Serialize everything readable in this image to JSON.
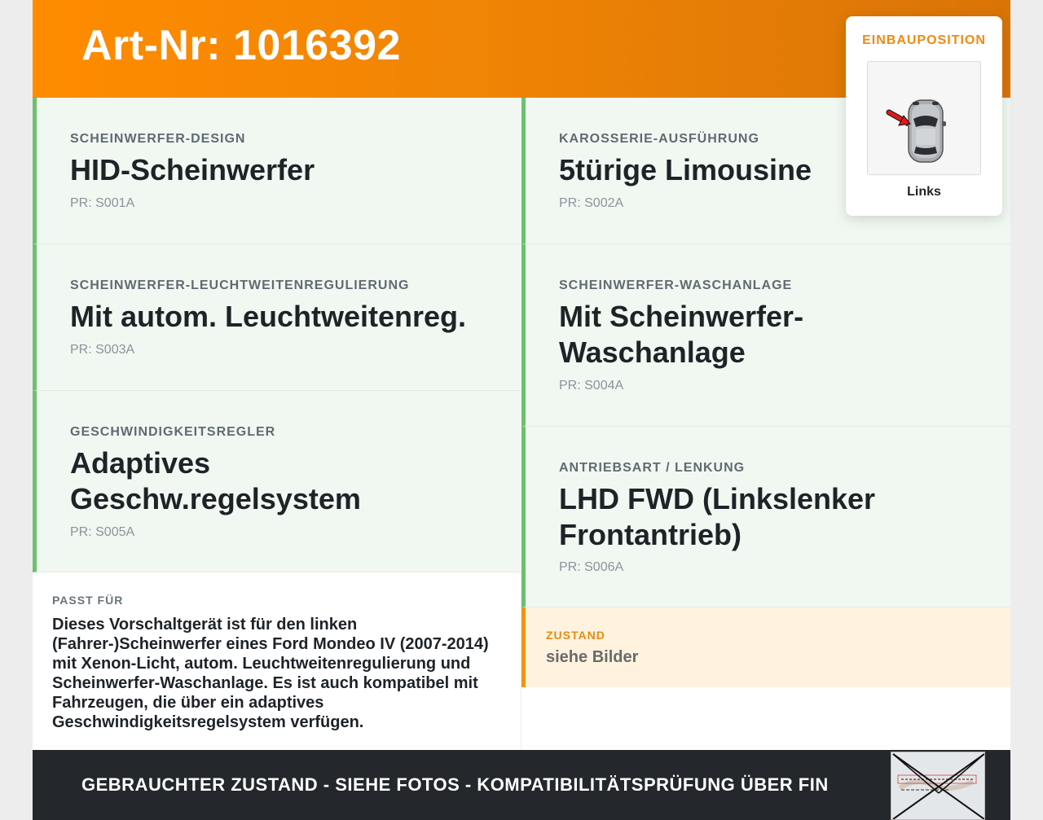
{
  "header": {
    "title": "Art-Nr: 1016392"
  },
  "specs": [
    {
      "label": "SCHEINWERFER-DESIGN",
      "value": "HID-Scheinwerfer",
      "pr": "PR: S001A"
    },
    {
      "label": "KAROSSERIE-AUSFÜHRUNG",
      "value": "5türige Limousine",
      "pr": "PR: S002A"
    },
    {
      "label": "SCHEINWERFER-LEUCHTWEITENREGULIERUNG",
      "value": "Mit autom. Leuchtweitenreg.",
      "pr": "PR: S003A"
    },
    {
      "label": "SCHEINWERFER-WASCHANLAGE",
      "value": "Mit Scheinwerfer-Waschanlage",
      "pr": "PR: S004A"
    },
    {
      "label": "GESCHWINDIGKEITSREGLER",
      "value": "Adaptives Geschw.regelsystem",
      "pr": "PR: S005A"
    },
    {
      "label": "ANTRIEBSART / LENKUNG",
      "value": "LHD FWD (Linkslenker Frontantrieb)",
      "pr": "PR: S006A"
    }
  ],
  "fits": {
    "label": "PASST FÜR",
    "text": "Dieses Vorschaltgerät ist für den linken (Fahrer-)Scheinwerfer eines Ford Mondeo IV (2007-2014) mit Xenon-Licht, autom. Leuchtweitenregulierung und Scheinwerfer-Waschanlage. Es ist auch kompatibel mit Fahrzeugen, die über ein adaptives Geschwindigkeitsregelsystem verfügen."
  },
  "condition": {
    "label": "ZUSTAND",
    "value": "siehe Bilder"
  },
  "footer": {
    "text": "GEBRAUCHTER ZUSTAND - SIEHE FOTOS - KOMPATIBILITÄTSPRÜFUNG ÜBER FIN"
  },
  "position": {
    "label": "EINBAUPOSITION",
    "side": "Links"
  },
  "colors": {
    "accent_orange": "#ff8c00",
    "spec_border_green": "#6cc070",
    "footer_dark": "#24272b"
  }
}
